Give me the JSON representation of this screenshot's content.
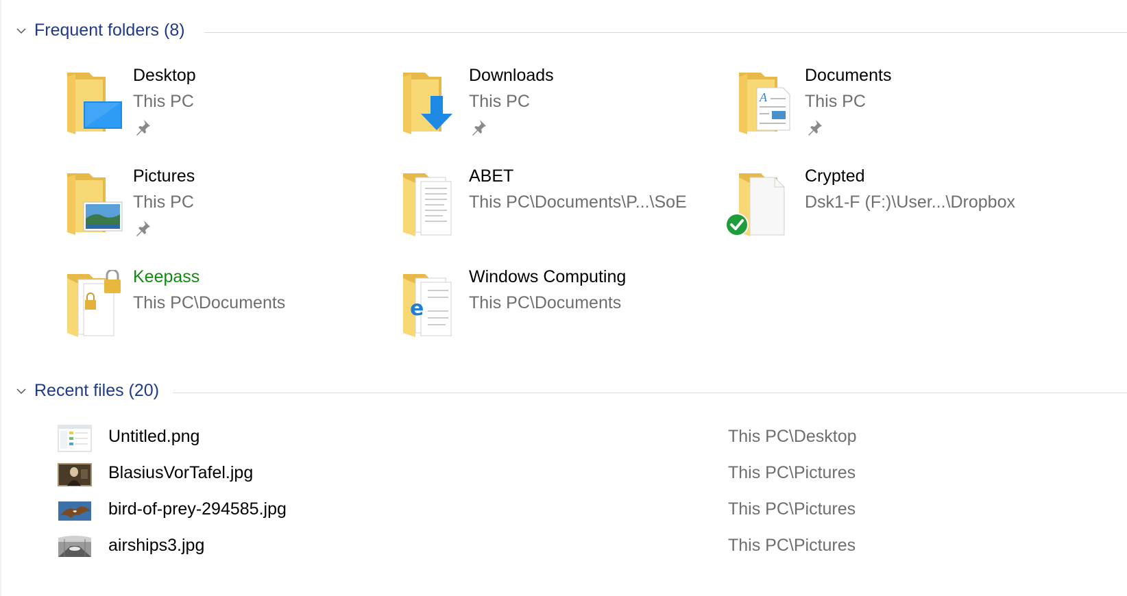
{
  "frequent_folders": {
    "header": "Frequent folders (8)",
    "items": [
      {
        "name": "Desktop",
        "location": "This PC",
        "pinned": true,
        "icon": "desktop-folder-icon"
      },
      {
        "name": "Downloads",
        "location": "This PC",
        "pinned": true,
        "icon": "downloads-folder-icon"
      },
      {
        "name": "Documents",
        "location": "This PC",
        "pinned": true,
        "icon": "documents-folder-icon"
      },
      {
        "name": "Pictures",
        "location": "This PC",
        "pinned": true,
        "icon": "pictures-folder-icon"
      },
      {
        "name": "ABET",
        "location": "This PC\\Documents\\P...\\SoE",
        "pinned": false,
        "icon": "folder-with-documents-icon"
      },
      {
        "name": "Crypted",
        "location": "Dsk1-F (F:)\\User...\\Dropbox",
        "pinned": false,
        "icon": "synced-folder-icon"
      },
      {
        "name": "Keepass",
        "location": "This PC\\Documents",
        "pinned": false,
        "icon": "locked-folder-icon",
        "name_color": "#128a12"
      },
      {
        "name": "Windows Computing",
        "location": "This PC\\Documents",
        "pinned": false,
        "icon": "edge-folder-icon"
      }
    ]
  },
  "recent_files": {
    "header": "Recent files (20)",
    "items": [
      {
        "name": "Untitled.png",
        "location": "This PC\\Desktop",
        "icon": "screenshot-thumbnail"
      },
      {
        "name": "BlasiusVorTafel.jpg",
        "location": "This PC\\Pictures",
        "icon": "photo-thumbnail"
      },
      {
        "name": "bird-of-prey-294585.jpg",
        "location": "This PC\\Pictures",
        "icon": "bird-photo-thumbnail"
      },
      {
        "name": "airships3.jpg",
        "location": "This PC\\Pictures",
        "icon": "hangar-photo-thumbnail"
      }
    ]
  },
  "colors": {
    "header_text": "#1e3a8a",
    "secondary_text": "#6e6e6e",
    "folder_yellow": "#f8d775",
    "folder_dark_yellow": "#e7b948",
    "accent_blue": "#1e88e5",
    "keepass_green": "#128a12"
  }
}
